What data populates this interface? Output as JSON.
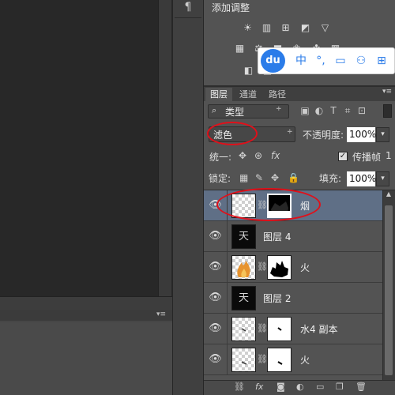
{
  "dock": {
    "panel_button_icon": "pilcrow-icon",
    "panel_button_glyph": "¶"
  },
  "adjustments": {
    "title": "添加调整",
    "row1_icons": [
      "brightness-icon",
      "levels-icon",
      "curves-icon",
      "exposure-icon",
      "triangle-icon"
    ],
    "row1_glyphs": [
      "☀",
      "▥",
      "⊞",
      "◩",
      "▽"
    ],
    "row2_icons": [
      "vibrance-icon",
      "balance-icon",
      "bw-icon",
      "photo-filter-icon",
      "mixer-icon",
      "lookup-icon"
    ],
    "row2_glyphs": [
      "▦",
      "⚖",
      "■",
      "❀",
      "✤",
      "▦"
    ],
    "row3_icons": [
      "invert-icon",
      "gradient-map-icon"
    ],
    "row3_glyphs": [
      "◧",
      "▧"
    ]
  },
  "ime": {
    "logo": "du",
    "items": [
      "中",
      "°,",
      "▭",
      "⚇",
      "⊞"
    ],
    "item_icons": [
      "chinese-mode-icon",
      "punctuation-icon",
      "keyboard-icon",
      "user-icon",
      "grid-icon"
    ]
  },
  "layers_panel": {
    "tabs": [
      "图层",
      "通道",
      "路径"
    ],
    "active_tab": "图层",
    "menu_glyph": "▾≡",
    "filter": {
      "label": "类型",
      "search_glyph": "⌕",
      "arrow": "÷"
    },
    "filter_icons": [
      "image-filter-icon",
      "adjustment-filter-icon",
      "type-filter-icon",
      "shape-filter-icon",
      "smart-object-filter-icon"
    ],
    "filter_glyphs": [
      "▣",
      "◐",
      "T",
      "⌗",
      "⊡"
    ],
    "blend_mode": "滤色",
    "blend_arrow": "÷",
    "opacity_label": "不透明度:",
    "opacity_value": "100%",
    "dropdown_glyph": "▾",
    "unify_label": "统一:",
    "unify_glyphs": [
      "✥",
      "⊛",
      "fx"
    ],
    "propagate_check": "✓",
    "propagate_label": "传播帧",
    "propagate_value": "1",
    "lock_label": "锁定:",
    "lock_glyphs": [
      "▦",
      "✎",
      "✥",
      "🔒"
    ],
    "fill_label": "填充:",
    "fill_value": "100%",
    "eye_glyph": "👁",
    "chain_glyph": "⛓",
    "layers": [
      {
        "name": "烟",
        "selected": true,
        "has_mask": true
      },
      {
        "name": "图层 4",
        "selected": false,
        "has_mask": false
      },
      {
        "name": "火",
        "selected": false,
        "has_mask": true
      },
      {
        "name": "图层 2",
        "selected": false,
        "has_mask": false
      },
      {
        "name": "水4 副本",
        "selected": false,
        "has_mask": true
      },
      {
        "name": "火",
        "selected": false,
        "has_mask": true
      }
    ],
    "thumb_text": "天",
    "footer_glyphs": [
      "⛓",
      "fx",
      "◙",
      "◐",
      "▭",
      "❐",
      "🗑"
    ],
    "footer_icons": [
      "link-icon",
      "fx-icon",
      "mask-icon",
      "adjustment-icon",
      "group-icon",
      "new-layer-icon",
      "trash-icon"
    ],
    "scroll_up_glyph": "▲"
  },
  "colors": {
    "selection_highlight": "#5f6f86",
    "annotation_red": "#e0101a",
    "ime_blue": "#2b7ce9"
  }
}
